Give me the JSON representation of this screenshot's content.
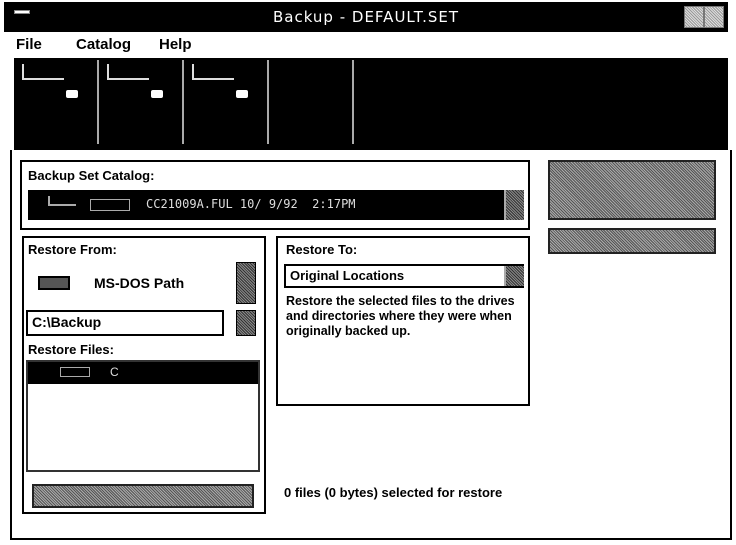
{
  "window": {
    "title": "Backup - DEFAULT.SET"
  },
  "menu": {
    "file": "File",
    "catalog": "Catalog",
    "help": "Help"
  },
  "catalog": {
    "label": "Backup Set Catalog:",
    "entry": "CC21009A.FUL 10/ 9/92  2:17PM"
  },
  "restore_from": {
    "label": "Restore From:",
    "device": "MS-DOS Path",
    "path": "C:\\Backup",
    "files_label": "Restore Files:",
    "files": [
      "C"
    ]
  },
  "restore_to": {
    "label": "Restore To:",
    "selected": "Original Locations",
    "description": "Restore the selected files to the drives and directories where they were when originally backed up."
  },
  "status": {
    "text": "0 files (0 bytes) selected for restore"
  }
}
